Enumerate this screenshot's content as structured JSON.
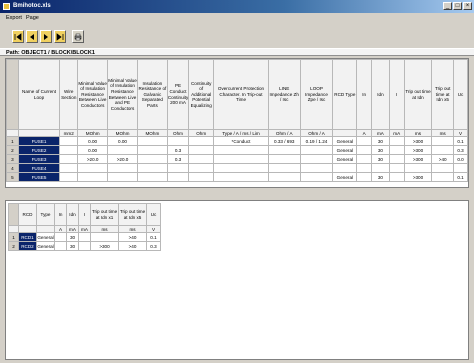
{
  "window": {
    "title": "Bmihotoc.xls"
  },
  "menu": [
    "Export",
    "Page"
  ],
  "path": "Path: OBJECT1 / BLOCK\\BLOCK1",
  "upper_table": {
    "headers": [
      "Name of Current Loop",
      "Wire Section",
      "Minimal Value of Insulation Resistance Between Live Conductors",
      "Minimal Value of Insulation Resistance Between Live and PE Conductors",
      "Insulation Resistance of Galvanic Separated Parts",
      "PE Conduct Continuity 200 mA",
      "Continuity of Additional Potential Equalizing",
      "Overcurrent Protection Character. In Trip-out Time",
      "LINE Impedance Zh / Isc",
      "LOOP Impedance Zpe / Isc",
      "RCD Type",
      "In",
      "Idn",
      "I",
      "Trip out time at Idn",
      "Trip out time at Idn x5",
      "Uc"
    ],
    "units": [
      "",
      "mm2",
      "MOhm",
      "MOhm",
      "MOhm",
      "Ohm",
      "Ohm",
      "Type / A / ms / Lim",
      "Ohm / A",
      "Ohm / A",
      "",
      "A",
      "mA",
      "mA",
      "ms",
      "ms",
      "V"
    ],
    "rows": [
      {
        "num": "1",
        "cells": [
          "FUSE1",
          "",
          "0.00",
          "0.00",
          "",
          "",
          "",
          "*Conduct",
          "0.33 / 693",
          "0.19 / 1.24",
          "General",
          "",
          "30",
          "",
          ">300",
          "",
          "0.1"
        ]
      },
      {
        "num": "2",
        "cells": [
          "FUSE2",
          "",
          "0.00",
          "",
          "",
          "0.3",
          "",
          "",
          "",
          "",
          "General",
          "",
          "30",
          "",
          ">300",
          "",
          "0.3"
        ]
      },
      {
        "num": "3",
        "cells": [
          "FUSE3",
          "",
          ">20.0",
          ">20.0",
          "",
          "0.3",
          "",
          "",
          "",
          "",
          "General",
          "",
          "30",
          "",
          ">300",
          ">40",
          "0.0"
        ]
      },
      {
        "num": "4",
        "cells": [
          "FUSE4",
          "",
          "",
          "",
          "",
          "",
          "",
          "",
          "",
          "",
          "",
          "",
          "",
          "",
          "",
          "",
          ""
        ]
      },
      {
        "num": "5",
        "cells": [
          "FUSE5",
          "",
          "",
          "",
          "",
          "",
          "",
          "",
          "",
          "",
          "General",
          "",
          "30",
          "",
          ">300",
          "",
          "0.1"
        ]
      }
    ]
  },
  "lower_table": {
    "headers": [
      "RCD",
      "Type",
      "In",
      "Idn",
      "I",
      "Trip out time at Idn x1",
      "Trip out time at Idn x5",
      "Uc"
    ],
    "units": [
      "",
      "",
      "A",
      "mA",
      "mA",
      "ms",
      "ms",
      "V"
    ],
    "rows": [
      {
        "num": "1",
        "cells": [
          "RCD1",
          "General",
          "",
          "30",
          "",
          "",
          ">40",
          "0.1"
        ]
      },
      {
        "num": "2",
        "cells": [
          "RCD2",
          "General",
          "",
          "30",
          "",
          ">300",
          ">40",
          "0.3"
        ]
      }
    ]
  }
}
